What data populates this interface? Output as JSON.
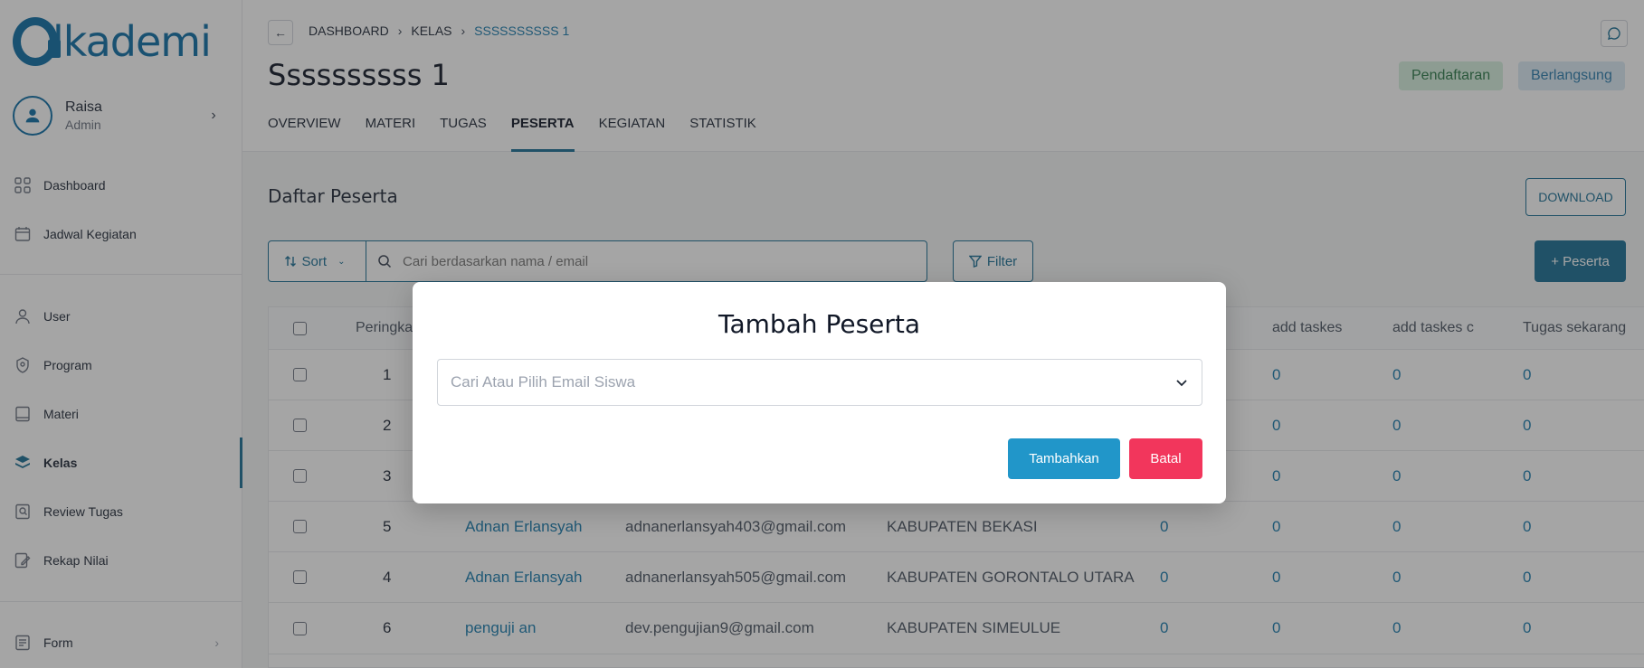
{
  "brand": {
    "logo_text": "lkademi",
    "color": "#0e6ea6"
  },
  "profile": {
    "name": "Raisa",
    "role": "Admin"
  },
  "sidebar": {
    "items": [
      {
        "label": "Dashboard",
        "icon": "grid-icon"
      },
      {
        "label": "Jadwal Kegiatan",
        "icon": "calendar-icon"
      },
      {
        "label": "User",
        "icon": "user-icon"
      },
      {
        "label": "Program",
        "icon": "badge-icon"
      },
      {
        "label": "Materi",
        "icon": "book-icon"
      },
      {
        "label": "Kelas",
        "icon": "layers-icon",
        "active": true
      },
      {
        "label": "Review Tugas",
        "icon": "review-icon"
      },
      {
        "label": "Rekap Nilai",
        "icon": "edit-doc-icon"
      },
      {
        "label": "Form",
        "icon": "form-icon"
      }
    ]
  },
  "breadcrumb": [
    "DASHBOARD",
    "KELAS",
    "SSSSSSSSSS 1"
  ],
  "page": {
    "title": "Ssssssssss 1",
    "badges": {
      "registration": "Pendaftaran",
      "ongoing": "Berlangsung"
    },
    "tabs": [
      "OVERVIEW",
      "MATERI",
      "TUGAS",
      "PESERTA",
      "KEGIATAN",
      "STATISTIK"
    ],
    "active_tab": "PESERTA"
  },
  "peserta": {
    "section_title": "Daftar Peserta",
    "download_label": "DOWNLOAD",
    "sort_label": "Sort",
    "search_placeholder": "Cari berdasarkan nama / email",
    "filter_label": "Filter",
    "add_label": "+ Peserta",
    "columns": [
      "Peringka",
      "add taskes",
      "add taskes c",
      "Tugas sekarang"
    ],
    "rows": [
      {
        "rank": "1",
        "name": "",
        "email": "",
        "region": "",
        "v1": "",
        "v2": "0",
        "v3": "0",
        "v4": "0"
      },
      {
        "rank": "2",
        "name": "",
        "email": "",
        "region": "",
        "v1": "",
        "v2": "0",
        "v3": "0",
        "v4": "0"
      },
      {
        "rank": "3",
        "name": "",
        "email": "",
        "region": "",
        "v1": "",
        "v2": "0",
        "v3": "0",
        "v4": "0"
      },
      {
        "rank": "5",
        "name": "Adnan Erlansyah",
        "email": "adnanerlansyah403@gmail.com",
        "region": "KABUPATEN BEKASI",
        "v1": "0",
        "v2": "0",
        "v3": "0",
        "v4": "0"
      },
      {
        "rank": "4",
        "name": "Adnan Erlansyah",
        "email": "adnanerlansyah505@gmail.com",
        "region": "KABUPATEN GORONTALO UTARA",
        "v1": "0",
        "v2": "0",
        "v3": "0",
        "v4": "0"
      },
      {
        "rank": "6",
        "name": "penguji an",
        "email": "dev.pengujian9@gmail.com",
        "region": "KABUPATEN SIMEULUE",
        "v1": "0",
        "v2": "0",
        "v3": "0",
        "v4": "0"
      }
    ]
  },
  "modal": {
    "title": "Tambah Peserta",
    "select_placeholder": "Cari Atau Pilih Email Siswa",
    "confirm_label": "Tambahkan",
    "cancel_label": "Batal"
  }
}
